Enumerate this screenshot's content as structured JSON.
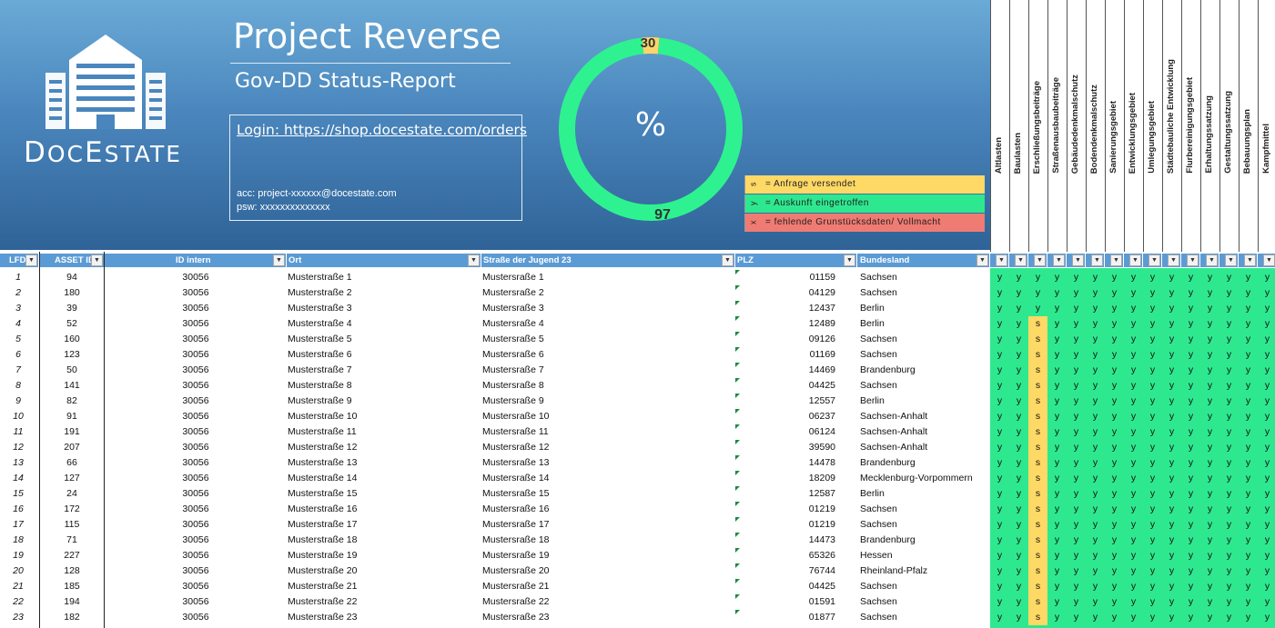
{
  "header": {
    "logo_text_a": "D",
    "logo_text_b": "OC",
    "logo_text_c": "E",
    "logo_text_d": "STATE",
    "title": "Project Reverse",
    "subtitle": "Gov-DD Status-Report",
    "login_link": "Login: https://shop.docestate.com/orders",
    "acc": "acc:  project-xxxxxx@docestate.com",
    "psw": "psw: xxxxxxxxxxxxxx"
  },
  "donut": {
    "center": "%",
    "segments": [
      {
        "label": "30",
        "value": 3,
        "color": "#fcd46a"
      },
      {
        "label": "97",
        "value": 97,
        "color": "#2ef28f"
      }
    ]
  },
  "legend": [
    {
      "key": "s",
      "label": "= Anfrage versendet",
      "color": "#ffd966"
    },
    {
      "key": "y",
      "label": "= Auskunft eingetroffen",
      "color": "#2ee88f"
    },
    {
      "key": "x",
      "label": "= fehlende Grunstücksdaten/ Vollmacht",
      "color": "#f07b72"
    }
  ],
  "status_columns": [
    "Altlasten",
    "Baulasten",
    "Erschließungsbeiträge",
    "Straßenausbaubeiträge",
    "Gebäudedenkmalschutz",
    "Bodendenkmalschutz",
    "Sanierungsgebiet",
    "Entwicklungsgebiet",
    "Umlegungsgebiet",
    "Städtebauliche Entwicklung",
    "Flurbereinigungsgebiet",
    "Erhaltungssatzung",
    "Gestaltungssatzung",
    "Bebauungsplan",
    "Kampfmittel"
  ],
  "table": {
    "headers": {
      "lfd": "LFD",
      "asset": "ASSET ID",
      "id": "ID intern",
      "ort": "Ort",
      "str": "Straße der Jugend 23",
      "plz": "PLZ",
      "bl": "Bundesland"
    },
    "dropdown_glyph": "▼",
    "rows": [
      {
        "lfd": "1",
        "asset": "94",
        "id": "30056",
        "ort": "Musterstraße 1",
        "str": "Mustersraße 1",
        "plz": "01159",
        "bl": "Sachsen",
        "s": "yyyyyyyyyyyyyyy"
      },
      {
        "lfd": "2",
        "asset": "180",
        "id": "30056",
        "ort": "Musterstraße 2",
        "str": "Mustersraße 2",
        "plz": "04129",
        "bl": "Sachsen",
        "s": "yyyyyyyyyyyyyyy"
      },
      {
        "lfd": "3",
        "asset": "39",
        "id": "30056",
        "ort": "Musterstraße 3",
        "str": "Mustersraße 3",
        "plz": "12437",
        "bl": "Berlin",
        "s": "yyyyyyyyyyyyyyy"
      },
      {
        "lfd": "4",
        "asset": "52",
        "id": "30056",
        "ort": "Musterstraße 4",
        "str": "Mustersraße 4",
        "plz": "12489",
        "bl": "Berlin",
        "s": "yysyyyyyyyyyyyy"
      },
      {
        "lfd": "5",
        "asset": "160",
        "id": "30056",
        "ort": "Musterstraße 5",
        "str": "Mustersraße 5",
        "plz": "09126",
        "bl": "Sachsen",
        "s": "yysyyyyyyyyyyyy"
      },
      {
        "lfd": "6",
        "asset": "123",
        "id": "30056",
        "ort": "Musterstraße 6",
        "str": "Mustersraße 6",
        "plz": "01169",
        "bl": "Sachsen",
        "s": "yysyyyyyyyyyyyy"
      },
      {
        "lfd": "7",
        "asset": "50",
        "id": "30056",
        "ort": "Musterstraße 7",
        "str": "Mustersraße 7",
        "plz": "14469",
        "bl": "Brandenburg",
        "s": "yysyyyyyyyyyyyy"
      },
      {
        "lfd": "8",
        "asset": "141",
        "id": "30056",
        "ort": "Musterstraße 8",
        "str": "Mustersraße 8",
        "plz": "04425",
        "bl": "Sachsen",
        "s": "yysyyyyyyyyyyyy"
      },
      {
        "lfd": "9",
        "asset": "82",
        "id": "30056",
        "ort": "Musterstraße 9",
        "str": "Mustersraße 9",
        "plz": "12557",
        "bl": "Berlin",
        "s": "yysyyyyyyyyyyyy"
      },
      {
        "lfd": "10",
        "asset": "91",
        "id": "30056",
        "ort": "Musterstraße 10",
        "str": "Mustersraße 10",
        "plz": "06237",
        "bl": "Sachsen-Anhalt",
        "s": "yysyyyyyyyyyyyy"
      },
      {
        "lfd": "11",
        "asset": "191",
        "id": "30056",
        "ort": "Musterstraße 11",
        "str": "Mustersraße 11",
        "plz": "06124",
        "bl": "Sachsen-Anhalt",
        "s": "yysyyyyyyyyyyyy"
      },
      {
        "lfd": "12",
        "asset": "207",
        "id": "30056",
        "ort": "Musterstraße 12",
        "str": "Mustersraße 12",
        "plz": "39590",
        "bl": "Sachsen-Anhalt",
        "s": "yysyyyyyyyyyyyy"
      },
      {
        "lfd": "13",
        "asset": "66",
        "id": "30056",
        "ort": "Musterstraße 13",
        "str": "Mustersraße 13",
        "plz": "14478",
        "bl": "Brandenburg",
        "s": "yysyyyyyyyyyyyy"
      },
      {
        "lfd": "14",
        "asset": "127",
        "id": "30056",
        "ort": "Musterstraße 14",
        "str": "Mustersraße 14",
        "plz": "18209",
        "bl": "Mecklenburg-Vorpommern",
        "s": "yysyyyyyyyyyyyy"
      },
      {
        "lfd": "15",
        "asset": "24",
        "id": "30056",
        "ort": "Musterstraße 15",
        "str": "Mustersraße 15",
        "plz": "12587",
        "bl": "Berlin",
        "s": "yysyyyyyyyyyyyy"
      },
      {
        "lfd": "16",
        "asset": "172",
        "id": "30056",
        "ort": "Musterstraße 16",
        "str": "Mustersraße 16",
        "plz": "01219",
        "bl": "Sachsen",
        "s": "yysyyyyyyyyyyyy"
      },
      {
        "lfd": "17",
        "asset": "115",
        "id": "30056",
        "ort": "Musterstraße 17",
        "str": "Mustersraße 17",
        "plz": "01219",
        "bl": "Sachsen",
        "s": "yysyyyyyyyyyyyy"
      },
      {
        "lfd": "18",
        "asset": "71",
        "id": "30056",
        "ort": "Musterstraße 18",
        "str": "Mustersraße 18",
        "plz": "14473",
        "bl": "Brandenburg",
        "s": "yysyyyyyyyyyyyy"
      },
      {
        "lfd": "19",
        "asset": "227",
        "id": "30056",
        "ort": "Musterstraße 19",
        "str": "Mustersraße 19",
        "plz": "65326",
        "bl": "Hessen",
        "s": "yysyyyyyyyyyyyy"
      },
      {
        "lfd": "20",
        "asset": "128",
        "id": "30056",
        "ort": "Musterstraße 20",
        "str": "Mustersraße 20",
        "plz": "76744",
        "bl": "Rheinland-Pfalz",
        "s": "yysyyyyyyyyyyyy"
      },
      {
        "lfd": "21",
        "asset": "185",
        "id": "30056",
        "ort": "Musterstraße 21",
        "str": "Mustersraße 21",
        "plz": "04425",
        "bl": "Sachsen",
        "s": "yysyyyyyyyyyyyy"
      },
      {
        "lfd": "22",
        "asset": "194",
        "id": "30056",
        "ort": "Musterstraße 22",
        "str": "Mustersraße 22",
        "plz": "01591",
        "bl": "Sachsen",
        "s": "yysyyyyyyyyyyyy"
      },
      {
        "lfd": "23",
        "asset": "182",
        "id": "30056",
        "ort": "Musterstraße 23",
        "str": "Mustersraße 23",
        "plz": "01877",
        "bl": "Sachsen",
        "s": "yysyyyyyyyyyyyy"
      }
    ]
  },
  "colors": {
    "status_y": "#2ee88f",
    "status_s": "#ffd966",
    "header_blue": "#5b9bd5"
  }
}
